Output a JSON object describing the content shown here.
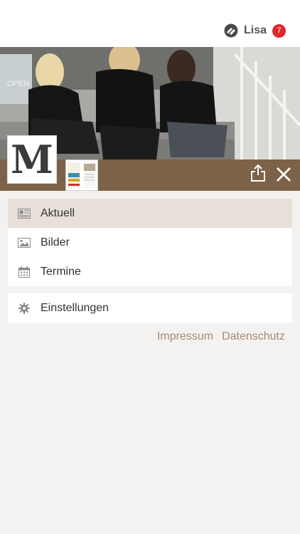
{
  "header": {
    "username": "Lisa",
    "notification_count": "7"
  },
  "menu": {
    "items": [
      {
        "label": "Aktuell",
        "icon": "newspaper-icon",
        "active": true
      },
      {
        "label": "Bilder",
        "icon": "image-icon",
        "active": false
      },
      {
        "label": "Termine",
        "icon": "calendar-icon",
        "active": false
      }
    ],
    "settings_label": "Einstellungen"
  },
  "footer": {
    "impressum": "Impressum",
    "datenschutz": "Datenschutz"
  },
  "brand": {
    "logo_letter": "M",
    "accent": "#7c6248",
    "link_color": "#a78a73",
    "badge_color": "#e0262a"
  }
}
